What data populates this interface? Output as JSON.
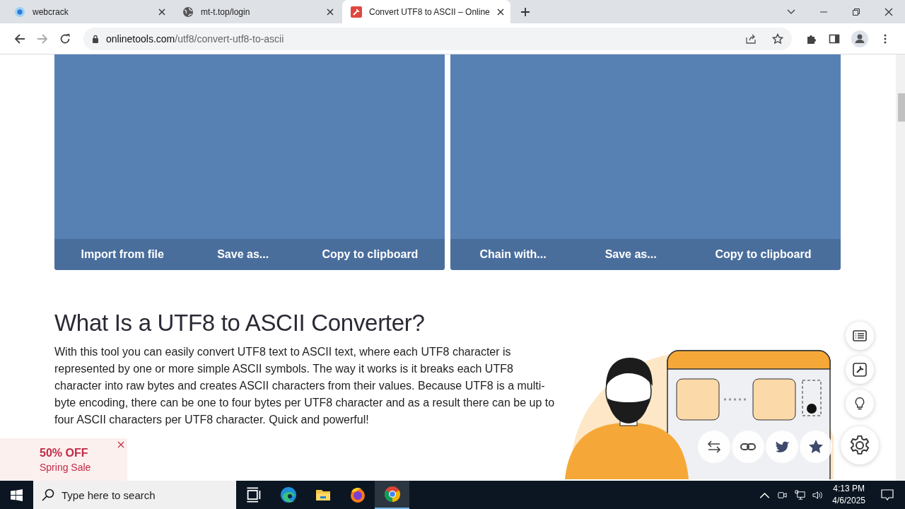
{
  "browser": {
    "tabs": [
      {
        "title": "webcrack",
        "selected": false
      },
      {
        "title": "mt-t.top/login",
        "selected": false
      },
      {
        "title": "Convert UTF8 to ASCII – Online",
        "selected": true
      }
    ],
    "address": {
      "domain": "onlinetools.com",
      "path": "/utf8/convert-utf8-to-ascii"
    }
  },
  "panels": [
    {
      "buttons": [
        "Import from file",
        "Save as...",
        "Copy to clipboard"
      ]
    },
    {
      "buttons": [
        "Chain with...",
        "Save as...",
        "Copy to clipboard"
      ]
    }
  ],
  "article": {
    "heading": "What Is a UTF8 to ASCII Converter?",
    "paragraph": "With this tool you can easily convert UTF8 text to ASCII text, where each UTF8 character is represented by one or more simple ASCII symbols. The way it works is it breaks each UTF8 character into raw bytes and creates ASCII characters from their values. Because UTF8 is a multi-byte encoding, there can be one to four bytes per UTF8 character and as a result there can be up to four ASCII characters per UTF8 character. Quick and powerful!"
  },
  "promo": {
    "title": "50% OFF",
    "subtitle": "Spring Sale"
  },
  "taskbar": {
    "search_placeholder": "Type here to search",
    "apps": [
      {
        "kind": "taskview",
        "selected": false
      },
      {
        "kind": "edge",
        "selected": false
      },
      {
        "kind": "folder",
        "selected": false
      },
      {
        "kind": "firefox",
        "selected": false
      },
      {
        "kind": "chrome",
        "selected": true
      }
    ],
    "time": "4:13 PM",
    "date": "4/6/2025"
  }
}
